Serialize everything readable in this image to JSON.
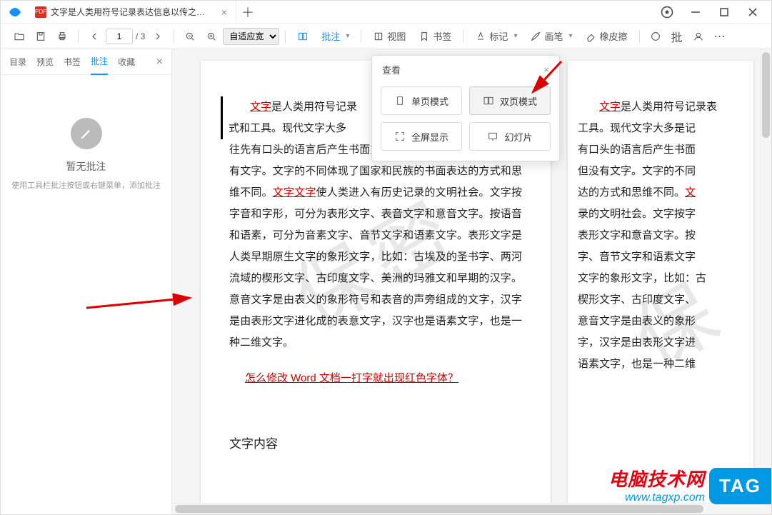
{
  "titlebar": {
    "tab_title": "文字是人类用符号记录表达信息以传之久远...",
    "pdf_badge": "PDF"
  },
  "toolbar": {
    "page_current": "1",
    "page_total": "/ 3",
    "zoom_mode": "自适应宽",
    "btn_annot": "批注",
    "btn_view": "视图",
    "btn_bookmark": "书签",
    "btn_mark": "标记",
    "btn_brush": "画笔",
    "btn_eraser": "橡皮擦",
    "btn_batch": "批"
  },
  "sidebar": {
    "tabs": [
      "目录",
      "预览",
      "书签",
      "批注",
      "收藏"
    ],
    "active_index": 3,
    "empty_title": "暂无批注",
    "empty_sub": "使用工具栏批注按钮或右键菜单，添加批注"
  },
  "popup": {
    "title": "查看",
    "buttons": [
      {
        "label": "单页模式",
        "selected": false
      },
      {
        "label": "双页模式",
        "selected": true
      },
      {
        "label": "全屏显示",
        "selected": false
      },
      {
        "label": "幻灯片",
        "selected": false
      }
    ]
  },
  "page1": {
    "red1": "文字",
    "t1a": "是人类用符号记录",
    "t1b": "式和工具。现代文字大多",
    "t1c": "往先有口头的语言后产生书面文字，很多小语种，有语言但没有文字。文字的不同体现了国家和民族的书面表达的方式和思维不同。",
    "red2": "文字文字",
    "t1d": "使人类进入有历史记录的文明社会。文字按字音和字形，可分为表形文字、表音文字和意音文字。按语音和语素，可分为音素文字、音节文字和语素文字。表形文字是人类早期原生文字的象形文字，比如：古埃及的圣书字、两河流域的楔形文字、古印度文字、美洲的玛雅文和早期的汉字。意音文字是由表义的象形符号和表音的声旁组成的文字，汉字是由表形文字进化成的表意文字，汉字也是语素文字，也是一种二维文字。",
    "link": "怎么修改 Word 文档一打字就出现红色字体？",
    "heading": "文字内容",
    "watermark": "保密"
  },
  "page2": {
    "red1": "文字",
    "lines": [
      "是人类用符号记录表",
      "工具。现代文字大多是记",
      "有口头的语言后产生书面",
      "但没有文字。文字的不同",
      "达的方式和思维不同。",
      "录的文明社会。文字按字",
      "表形文字和意音文字。按",
      "字、音节文字和语素文字",
      "文字的象形文字，比如：古",
      "楔形文字、古印度文字、",
      "意音文字是由表义的象形",
      "字，汉字是由表形文字进",
      "语素文字，也是一种二维"
    ],
    "red2": "文"
  },
  "badge": {
    "cn": "电脑技术网",
    "url": "www.tagxp.com",
    "tag": "TAG"
  }
}
